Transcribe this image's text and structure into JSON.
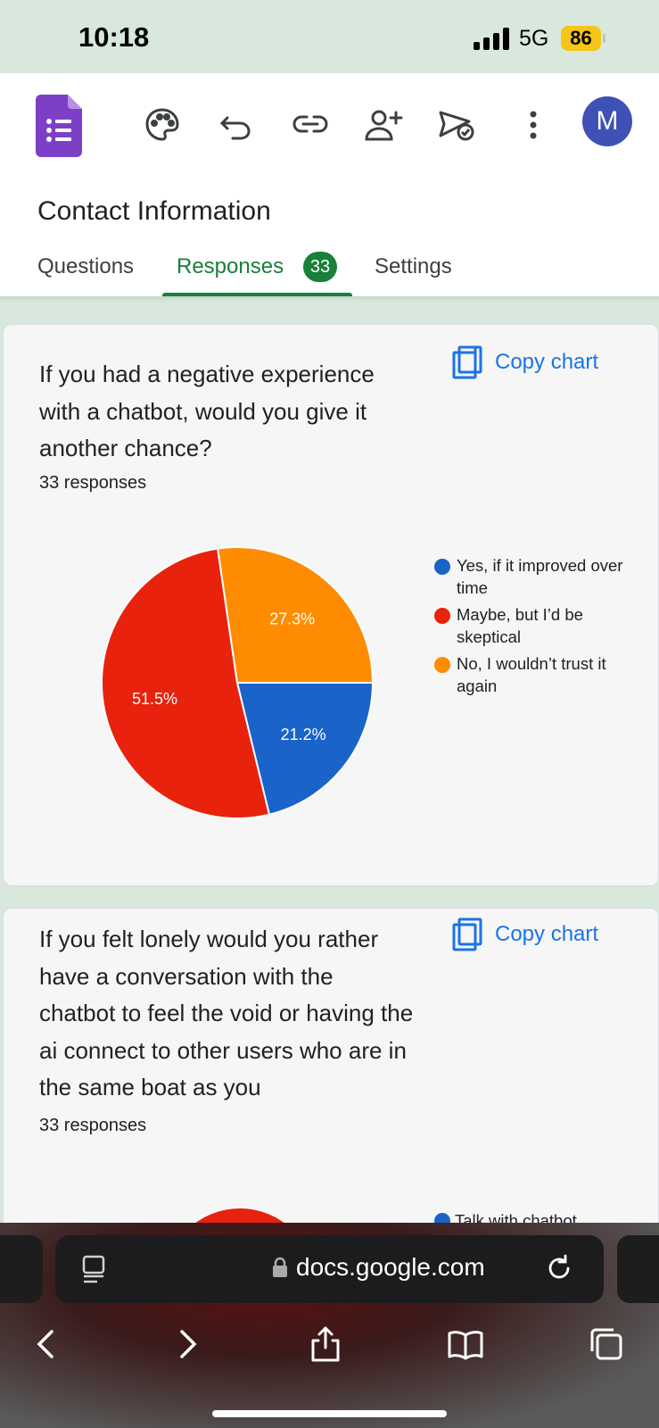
{
  "status_bar": {
    "time": "10:18",
    "network": "5G",
    "battery": "86"
  },
  "header": {
    "form_title": "Contact Information",
    "avatar_initial": "M",
    "tabs": [
      {
        "label": "Questions"
      },
      {
        "label": "Responses",
        "badge": "33",
        "active": true
      },
      {
        "label": "Settings"
      }
    ]
  },
  "cards": [
    {
      "question": "If you had a negative experience with a chatbot, would you give it another chance?",
      "responses": "33 responses",
      "copy_label": "Copy chart",
      "chart_data": {
        "type": "pie",
        "categories": [
          "Yes, if it improved over time",
          "Maybe, but I’d be skeptical",
          "No, I wouldn’t trust it again"
        ],
        "values": [
          21.2,
          51.5,
          27.3
        ],
        "value_labels": [
          "21.2%",
          "51.5%",
          "27.3%"
        ],
        "colors": [
          "#1a63c9",
          "#e8220c",
          "#ff8c00"
        ],
        "legend": "right"
      }
    },
    {
      "question": "If you felt lonely would you rather have a conversation with the chatbot to feel the void or having the ai connect to other users who are in the same boat as you",
      "responses": "33 responses",
      "copy_label": "Copy chart",
      "legend_peek": "Talk with chatbot"
    }
  ],
  "safari": {
    "url": "docs.google.com"
  }
}
